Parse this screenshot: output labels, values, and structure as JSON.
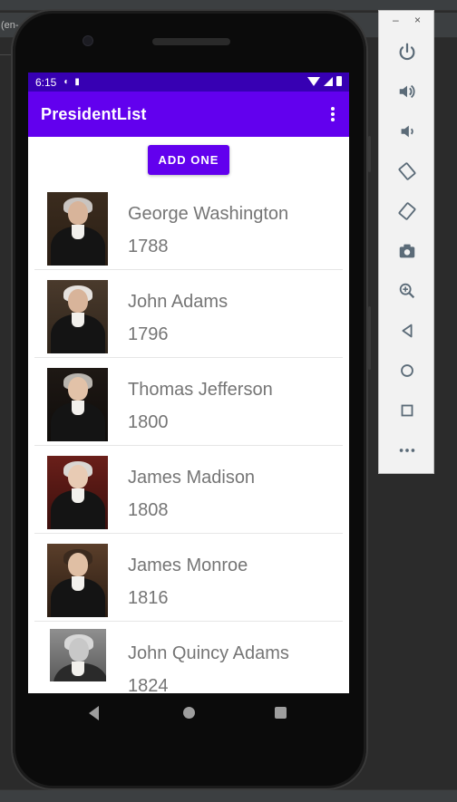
{
  "ide": {
    "tab_fragment": "(en-"
  },
  "status_bar": {
    "time": "6:15"
  },
  "app_bar": {
    "title": "PresidentList"
  },
  "add_button": {
    "label": "ADD ONE"
  },
  "presidents": [
    {
      "name": "George Washington",
      "year": "1788"
    },
    {
      "name": "John Adams",
      "year": "1796"
    },
    {
      "name": "Thomas Jefferson",
      "year": "1800"
    },
    {
      "name": "James Madison",
      "year": "1808"
    },
    {
      "name": "James Monroe",
      "year": "1816"
    },
    {
      "name": "John Quincy Adams",
      "year": "1824"
    }
  ],
  "emulator_panel": {
    "minimize": "–",
    "close": "×",
    "buttons": [
      "power-icon",
      "volume-up-icon",
      "volume-down-icon",
      "rotate-left-icon",
      "rotate-right-icon",
      "camera-icon",
      "zoom-icon",
      "back-icon",
      "home-icon",
      "overview-icon",
      "more-icon"
    ]
  },
  "colors": {
    "primary": "#6200ee",
    "primary_dark": "#3700b3",
    "item_text": "#757575"
  }
}
